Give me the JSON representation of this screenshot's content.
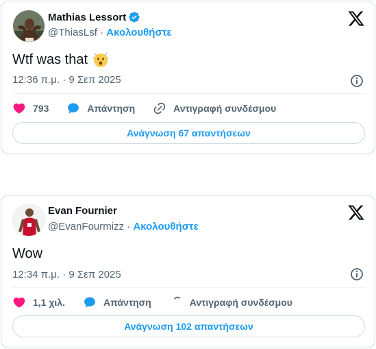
{
  "tweets": [
    {
      "display_name": "Mathias Lessort",
      "verified": true,
      "handle": "@ThiasLsf",
      "separator": "·",
      "follow_label": "Ακολουθήστε",
      "text": "Wtf was that",
      "emoji": "astonished-face-emoji",
      "timestamp": "12:36 π.μ. · 9 Σεπ 2025",
      "like_count": "793",
      "reply_label": "Απάντηση",
      "copy_link_label": "Αντιγραφή συνδέσμου",
      "read_replies_label": "Ανάγνωση 67 απαντήσεων"
    },
    {
      "display_name": "Evan Fournier",
      "verified": false,
      "handle": "@EvanFourmizz",
      "separator": "·",
      "follow_label": "Ακολουθήστε",
      "text": "Wow",
      "timestamp": "12:34 π.μ. · 9 Σεπ 2025",
      "like_count": "1,1 χιλ.",
      "reply_label": "Απάντηση",
      "copy_link_label": "Αντιγραφή συνδέσμου",
      "read_replies_label": "Ανάγνωση 102 απαντήσεων"
    }
  ],
  "colors": {
    "accent": "#1d9bf0",
    "like": "#f91880",
    "text": "#0f1419",
    "muted": "#536471",
    "border": "#cfd9de"
  },
  "icons": [
    "verified-badge-icon",
    "x-logo-icon",
    "info-icon",
    "heart-icon",
    "reply-bubble-icon",
    "link-icon"
  ]
}
